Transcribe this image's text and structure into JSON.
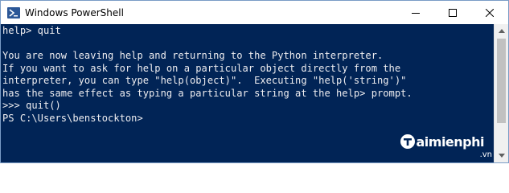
{
  "window": {
    "title": "Windows PowerShell",
    "controls": {
      "minimize": "—",
      "maximize": "☐",
      "close": "✕"
    }
  },
  "console": {
    "lines": [
      "help> quit",
      "",
      "You are now leaving help and returning to the Python interpreter.",
      "If you want to ask for help on a particular object directly from the",
      "interpreter, you can type \"help(object)\".  Executing \"help('string')\"",
      "has the same effect as typing a particular string at the help> prompt.",
      ">>> quit()",
      "PS C:\\Users\\benstockton>"
    ]
  },
  "watermark": {
    "brand": "aimienphi",
    "tld": ".vn"
  },
  "colors": {
    "console_bg": "#012456",
    "console_fg": "#eeedf0",
    "titlebar_bg": "#ffffff"
  },
  "icons": {
    "app": "powershell-icon",
    "scroll_up": "arrow-up-icon",
    "scroll_down": "arrow-down-icon"
  }
}
